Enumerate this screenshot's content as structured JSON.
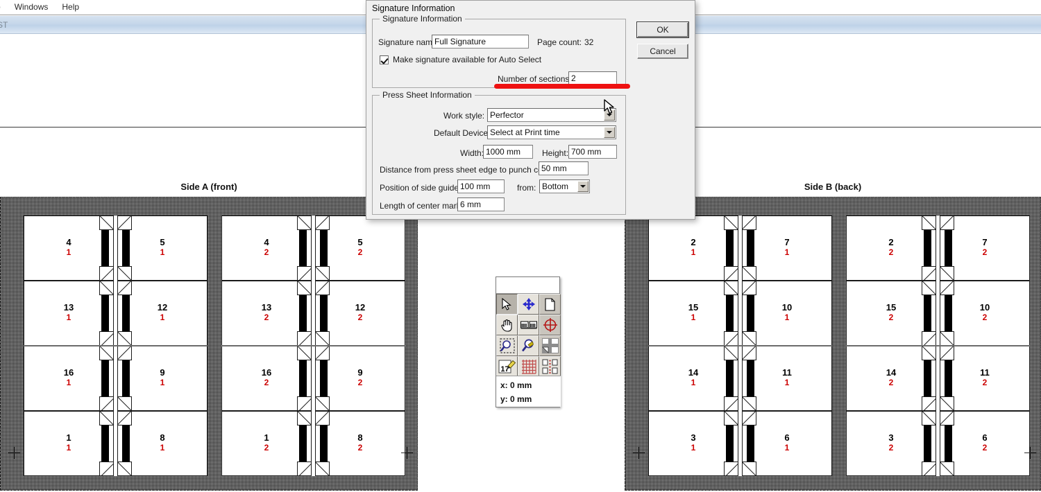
{
  "menubar": {
    "items": [
      {
        "label": "o",
        "clipped": true
      },
      {
        "label": "Windows",
        "clipped": false
      },
      {
        "label": "Help",
        "clipped": false
      }
    ]
  },
  "document_titlebar": {
    "title": "ST"
  },
  "sheets": [
    {
      "id": "side-a",
      "caption": "Side A (front)",
      "sections": [
        {
          "rows": [
            [
              {
                "page": "4",
                "section": "1",
                "spine": "right"
              },
              {
                "page": "5",
                "section": "1",
                "spine": "left"
              }
            ],
            [
              {
                "page": "13",
                "section": "1",
                "spine": "right"
              },
              {
                "page": "12",
                "section": "1",
                "spine": "left"
              }
            ],
            [
              {
                "page": "16",
                "section": "1",
                "spine": "right"
              },
              {
                "page": "9",
                "section": "1",
                "spine": "left"
              }
            ],
            [
              {
                "page": "1",
                "section": "1",
                "spine": "right"
              },
              {
                "page": "8",
                "section": "1",
                "spine": "left"
              }
            ]
          ]
        },
        {
          "rows": [
            [
              {
                "page": "4",
                "section": "2",
                "spine": "right"
              },
              {
                "page": "5",
                "section": "2",
                "spine": "left"
              }
            ],
            [
              {
                "page": "13",
                "section": "2",
                "spine": "right"
              },
              {
                "page": "12",
                "section": "2",
                "spine": "left"
              }
            ],
            [
              {
                "page": "16",
                "section": "2",
                "spine": "right"
              },
              {
                "page": "9",
                "section": "2",
                "spine": "left"
              }
            ],
            [
              {
                "page": "1",
                "section": "2",
                "spine": "right"
              },
              {
                "page": "8",
                "section": "2",
                "spine": "left"
              }
            ]
          ]
        }
      ]
    },
    {
      "id": "side-b",
      "caption": "Side B (back)",
      "sections": [
        {
          "rows": [
            [
              {
                "page": "2",
                "section": "1",
                "spine": "right"
              },
              {
                "page": "7",
                "section": "1",
                "spine": "left"
              }
            ],
            [
              {
                "page": "15",
                "section": "1",
                "spine": "right"
              },
              {
                "page": "10",
                "section": "1",
                "spine": "left"
              }
            ],
            [
              {
                "page": "14",
                "section": "1",
                "spine": "right"
              },
              {
                "page": "11",
                "section": "1",
                "spine": "left"
              }
            ],
            [
              {
                "page": "3",
                "section": "1",
                "spine": "right"
              },
              {
                "page": "6",
                "section": "1",
                "spine": "left"
              }
            ]
          ]
        },
        {
          "rows": [
            [
              {
                "page": "2",
                "section": "2",
                "spine": "right"
              },
              {
                "page": "7",
                "section": "2",
                "spine": "left"
              }
            ],
            [
              {
                "page": "15",
                "section": "2",
                "spine": "right"
              },
              {
                "page": "10",
                "section": "2",
                "spine": "left"
              }
            ],
            [
              {
                "page": "14",
                "section": "2",
                "spine": "right"
              },
              {
                "page": "11",
                "section": "2",
                "spine": "left"
              }
            ],
            [
              {
                "page": "3",
                "section": "2",
                "spine": "right"
              },
              {
                "page": "6",
                "section": "2",
                "spine": "left"
              }
            ]
          ]
        }
      ]
    }
  ],
  "tool_palette": {
    "tools": [
      {
        "name": "selection-arrow-icon",
        "selected": true
      },
      {
        "name": "move-tool-icon",
        "selected": false
      },
      {
        "name": "page-tool-icon",
        "selected": false
      },
      {
        "name": "hand-tool-icon",
        "selected": false
      },
      {
        "name": "signature-tool-icon",
        "selected": false
      },
      {
        "name": "registration-mark-icon",
        "selected": false
      },
      {
        "name": "zoom-marquee-icon",
        "selected": false
      },
      {
        "name": "magnifier-icon",
        "selected": false
      },
      {
        "name": "section-layout-icon",
        "selected": false
      },
      {
        "name": "page-numbering-icon",
        "selected": false
      },
      {
        "name": "grid-tool-icon",
        "selected": false
      },
      {
        "name": "fold-pattern-icon",
        "selected": false
      }
    ],
    "numbering_tool_value": "17",
    "coordinates": {
      "x": "x: 0 mm",
      "y": "y: 0 mm"
    }
  },
  "dialog": {
    "title": "Signature Information",
    "signature_group": {
      "legend": "Signature Information",
      "signature_name_label": "Signature name:",
      "signature_name_value": "Full Signature",
      "page_count_label": "Page count:",
      "page_count_value": "32",
      "auto_select_label": "Make signature available for Auto Select",
      "auto_select_checked": true,
      "sections_label": "Number of sections:",
      "sections_value": "2"
    },
    "press_sheet_group": {
      "legend": "Press Sheet Information",
      "work_style_label": "Work style:",
      "work_style_value": "Perfector",
      "default_device_label": "Default Device:",
      "default_device_value": "Select at Print time",
      "width_label": "Width:",
      "width_value": "1000 mm",
      "height_label": "Height:",
      "height_value": "700 mm",
      "punch_label": "Distance from press sheet edge to punch center:",
      "punch_value": "50 mm",
      "side_guides_label": "Position of side guides:",
      "side_guides_value": "100 mm",
      "from_label": "from:",
      "from_value": "Bottom",
      "center_marks_label": "Length of center marks:",
      "center_marks_value": "6 mm"
    },
    "buttons": {
      "ok": "OK",
      "cancel": "Cancel"
    }
  },
  "annotation": {
    "color": "#ee1111",
    "name": "red-underline-highlight"
  }
}
